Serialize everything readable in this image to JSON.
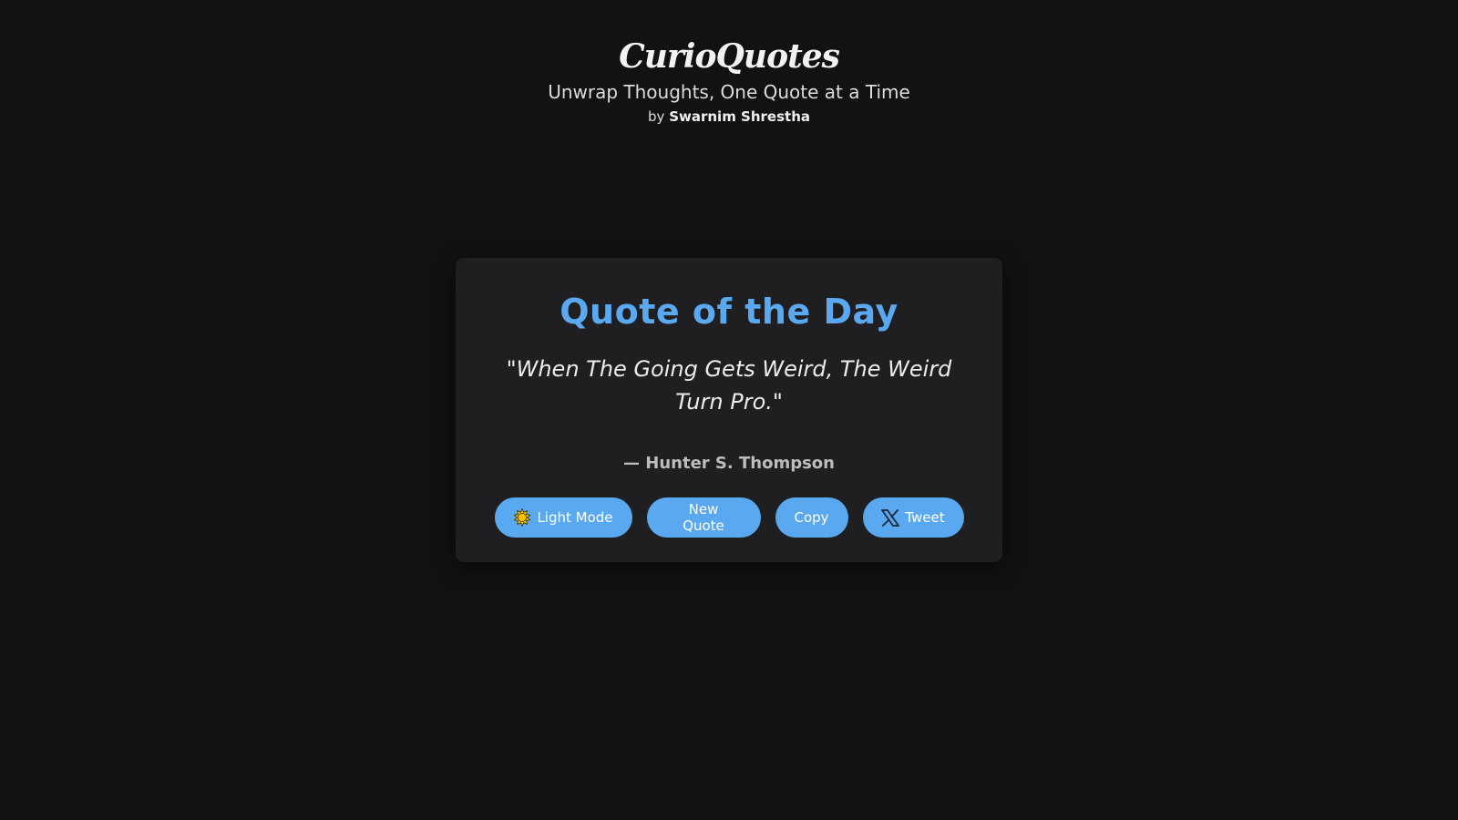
{
  "header": {
    "brand": "CurioQuotes",
    "tagline": "Unwrap Thoughts, One Quote at a Time",
    "byline_prefix": "by",
    "author_name": "Swarnim Shrestha"
  },
  "card": {
    "title": "Quote of the Day",
    "quote": "\"When The Going Gets Weird, The Weird Turn Pro.\"",
    "author": "— Hunter S. Thompson"
  },
  "actions": {
    "light_mode_label": "Light Mode",
    "light_mode_icon": "sun-icon",
    "new_quote_label": "New Quote",
    "copy_label": "Copy",
    "tweet_label": "Tweet",
    "tweet_icon": "x-logo-icon"
  },
  "colors": {
    "background": "#121214",
    "card": "#1f1f21",
    "accent": "#5aa9f0",
    "sun": "#f5c400"
  }
}
